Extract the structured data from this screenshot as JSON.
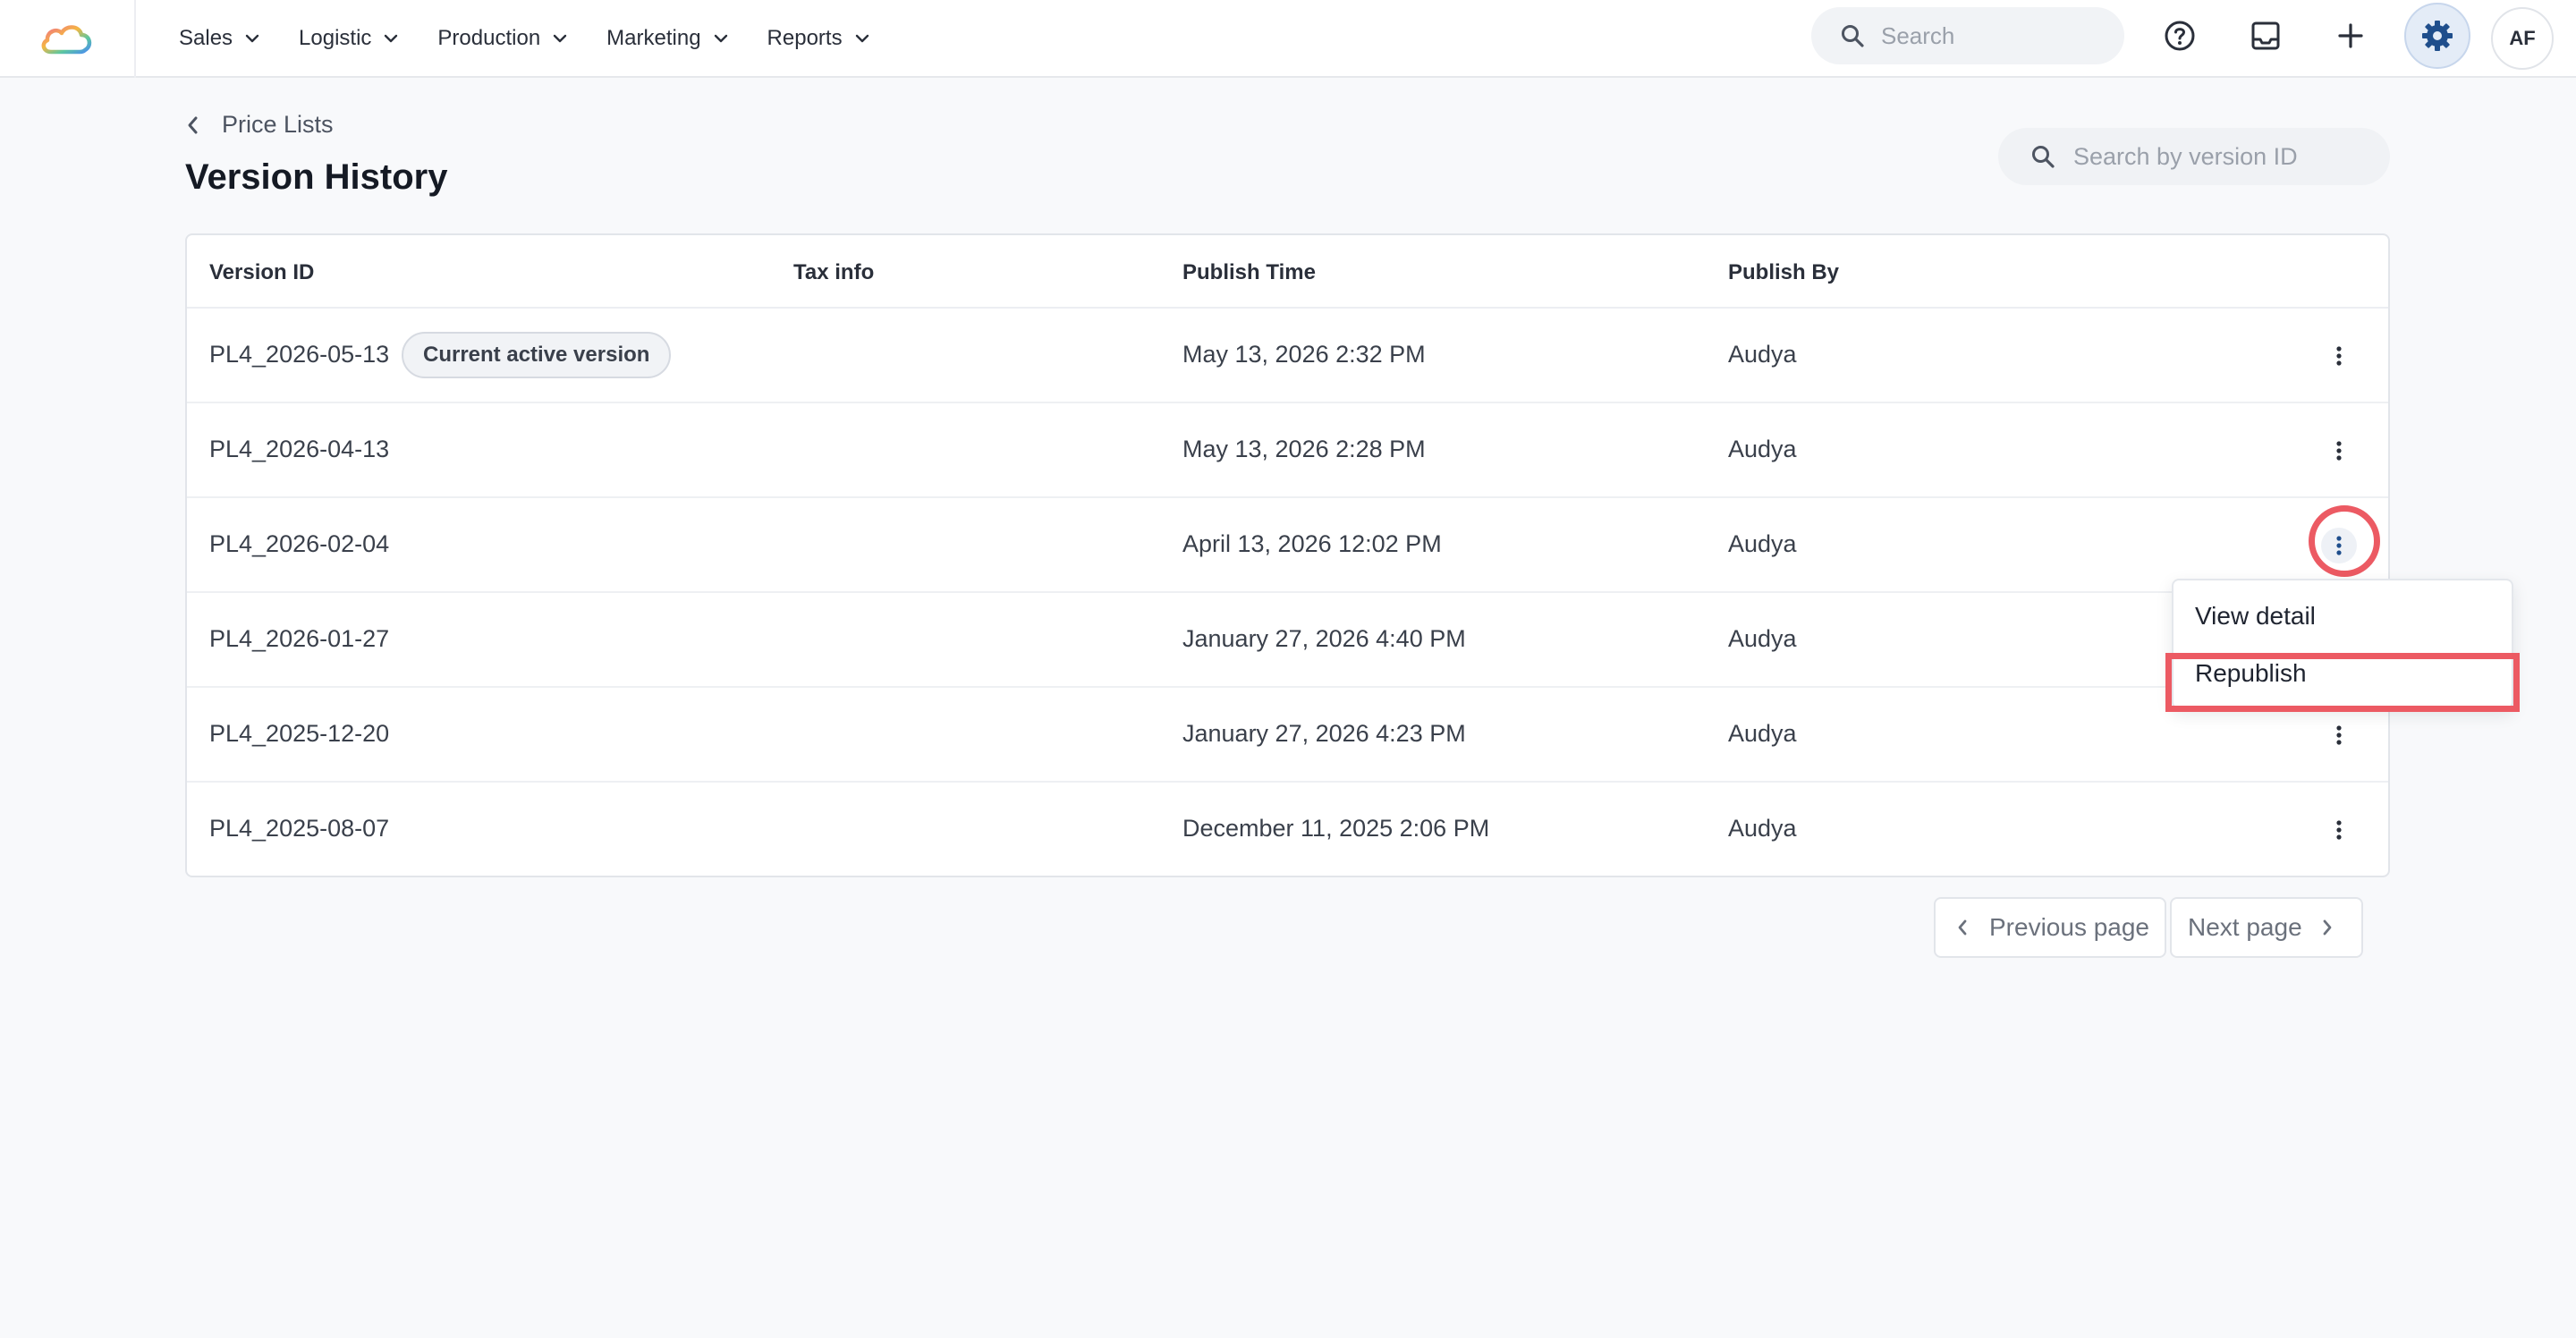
{
  "topnav": {
    "menus": [
      {
        "label": "Sales"
      },
      {
        "label": "Logistic"
      },
      {
        "label": "Production"
      },
      {
        "label": "Marketing"
      },
      {
        "label": "Reports"
      }
    ],
    "search_placeholder": "Search",
    "avatar_initials": "AF",
    "icons": [
      "cloud-logo-icon",
      "search-icon",
      "help-icon",
      "inbox-icon",
      "plus-icon",
      "gear-icon"
    ]
  },
  "page": {
    "breadcrumb": "Price Lists",
    "title": "Version History",
    "search_placeholder": "Search by version ID"
  },
  "table": {
    "columns": [
      "Version ID",
      "Tax info",
      "Publish Time",
      "Publish By"
    ],
    "rows": [
      {
        "version_id": "PL4_2026-05-13",
        "badge": "Current active version",
        "tax_info": "",
        "publish_time": "May 13, 2026 2:32 PM",
        "publish_by": "Audya"
      },
      {
        "version_id": "PL4_2026-04-13",
        "tax_info": "",
        "publish_time": "May 13, 2026 2:28 PM",
        "publish_by": "Audya"
      },
      {
        "version_id": "PL4_2026-02-04",
        "tax_info": "",
        "publish_time": "April 13, 2026 12:02 PM",
        "publish_by": "Audya"
      },
      {
        "version_id": "PL4_2026-01-27",
        "tax_info": "",
        "publish_time": "January 27, 2026 4:40 PM",
        "publish_by": "Audya"
      },
      {
        "version_id": "PL4_2025-12-20",
        "tax_info": "",
        "publish_time": "January 27, 2026 4:23 PM",
        "publish_by": "Audya"
      },
      {
        "version_id": "PL4_2025-08-07",
        "tax_info": "",
        "publish_time": "December 11, 2025 2:06 PM",
        "publish_by": "Audya"
      }
    ]
  },
  "row_menu": {
    "items": [
      "View detail",
      "Republish"
    ]
  },
  "pagination": {
    "previous": "Previous page",
    "next": "Next page"
  },
  "colors": {
    "highlight": "#ec5a63",
    "accent": "#1f4e8c",
    "background": "#f8f9fb"
  }
}
